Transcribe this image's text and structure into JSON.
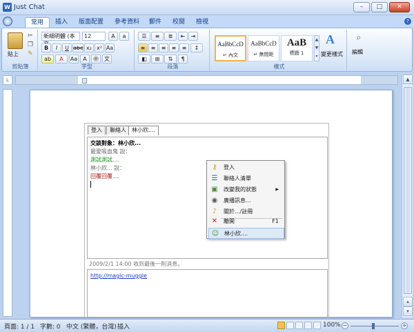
{
  "window": {
    "title": "Just Chat",
    "app_icon": "W",
    "min_label": "–",
    "max_label": "□",
    "close_label": "✕"
  },
  "ribbon": {
    "tabs": [
      "常用",
      "插入",
      "版面配置",
      "參考資料",
      "郵件",
      "校閱",
      "檢視"
    ],
    "active_tab": 0,
    "clipboard": {
      "paste_label": "貼上",
      "group_label": "剪貼簿"
    },
    "font": {
      "font_name": "新細明體 (本文",
      "font_size": "12",
      "group_label": "字型"
    },
    "paragraph": {
      "group_label": "段落"
    },
    "styles": {
      "group_label": "樣式",
      "items": [
        {
          "preview": "AaBbCcD",
          "name": "↵ 內文"
        },
        {
          "preview": "AaBbCcD",
          "name": "↵ 無間距"
        },
        {
          "preview": "AaB",
          "name": "標題 1"
        }
      ],
      "change_label": "變更樣式"
    },
    "editing": {
      "label": "編輯"
    }
  },
  "statusbar": {
    "page": "頁面: 1 / 1",
    "words": "字數: 0",
    "language": "中文 (繁體，台灣)",
    "mode": "插入",
    "zoom": "100%"
  },
  "chat": {
    "tabs": [
      "登入",
      "聯絡人",
      "林小欣...."
    ],
    "active_tab": 2,
    "messages": [
      {
        "text": "交談對象：林小欣...",
        "color": "#000000",
        "bold": true
      },
      {
        "text": "最愛吸血鬼 說：",
        "color": "#666666",
        "bold": false
      },
      {
        "text": "測試測試....",
        "color": "#1a8f1a",
        "bold": false
      },
      {
        "text": "林小欣... 說：",
        "color": "#666666",
        "bold": false
      },
      {
        "text": "回覆回覆....",
        "color": "#b01a1a",
        "bold": false
      }
    ],
    "status_line": "2009/2/1 14:00 收到最後一則消息。",
    "input_link": "http://magic-muggle"
  },
  "context_menu": {
    "items": [
      {
        "label": "登入",
        "icon": "key-icon",
        "glyph": "🔑",
        "color": "#c8a000"
      },
      {
        "label": "聯絡人清單",
        "icon": "contacts-list-icon",
        "glyph": "☰",
        "color": "#2f63b8"
      },
      {
        "label": "改變我的狀態",
        "icon": "status-icon",
        "glyph": "▣",
        "color": "#4a8a3a",
        "submenu": "▶"
      },
      {
        "label": "廣播訊息...",
        "icon": "broadcast-icon",
        "glyph": "◉",
        "color": "#555555"
      },
      {
        "label": "關於.../註冊",
        "icon": "bell-icon",
        "glyph": "🔔",
        "color": "#d4a000"
      },
      {
        "label": "離開",
        "icon": "close-icon",
        "glyph": "✕",
        "color": "#c81e1e",
        "shortcut": "F1"
      },
      {
        "label": "林小欣....",
        "icon": "user-icon",
        "glyph": "👤",
        "color": "#3a9a3a"
      }
    ]
  }
}
